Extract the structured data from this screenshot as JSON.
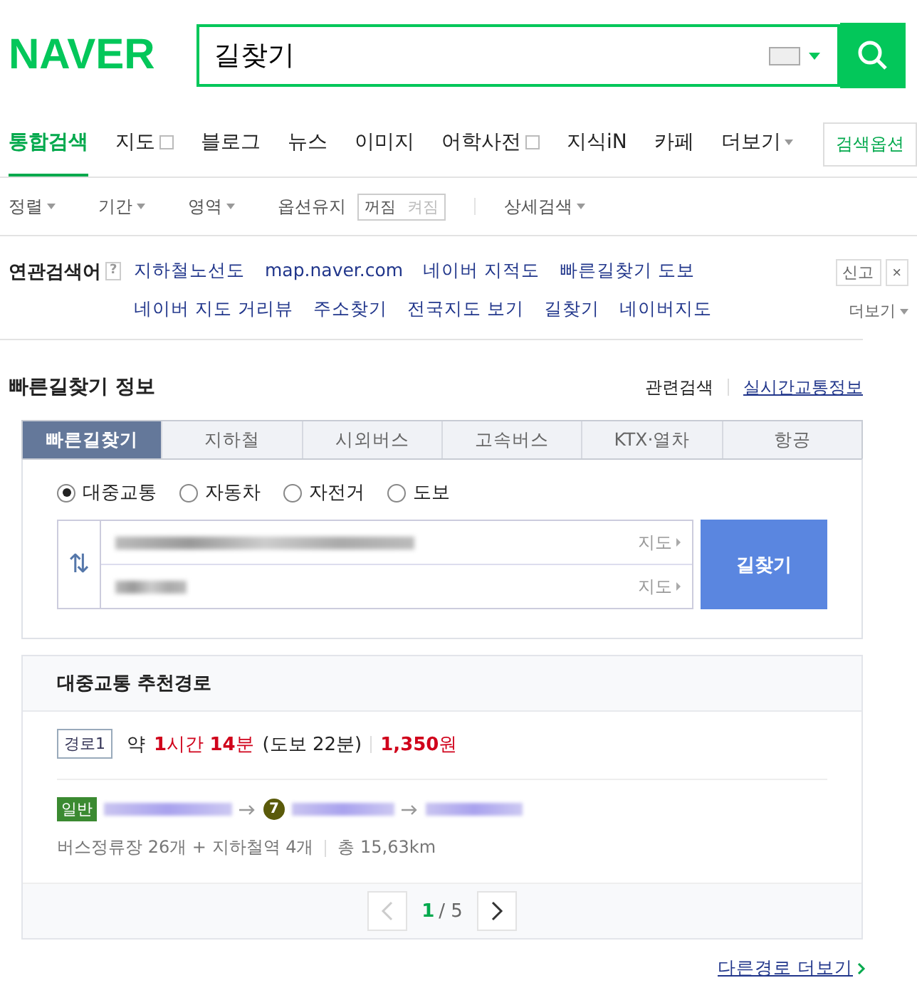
{
  "logo": "NAVER",
  "search": {
    "value": "길찾기"
  },
  "nav_tabs": [
    {
      "label": "통합검색",
      "selected": true
    },
    {
      "label": "지도",
      "selected": false,
      "popup": true
    },
    {
      "label": "블로그",
      "selected": false
    },
    {
      "label": "뉴스",
      "selected": false
    },
    {
      "label": "이미지",
      "selected": false
    },
    {
      "label": "어학사전",
      "selected": false,
      "popup": true
    },
    {
      "label": "지식iN",
      "selected": false
    },
    {
      "label": "카페",
      "selected": false
    },
    {
      "label": "더보기",
      "selected": false,
      "dropdown": true
    }
  ],
  "search_options_button": "검색옵션",
  "filters": [
    {
      "label": "정렬"
    },
    {
      "label": "기간"
    },
    {
      "label": "영역"
    }
  ],
  "option_keep": {
    "label": "옵션유지",
    "choices": [
      {
        "label": "꺼짐",
        "selected": true
      },
      {
        "label": "켜짐",
        "selected": false
      }
    ]
  },
  "detail_search": "상세검색",
  "related": {
    "title": "연관검색어",
    "help": "?",
    "report": "신고",
    "close": "×",
    "more": "더보기",
    "rows": [
      [
        "지하철노선도",
        "map.naver.com",
        "네이버 지적도",
        "빠른길찾기 도보"
      ],
      [
        "네이버 지도 거리뷰",
        "주소찾기",
        "전국지도 보기",
        "길찾기",
        "네이버지도"
      ]
    ]
  },
  "section": {
    "title": "빠른길찾기 정보",
    "links": [
      {
        "label": "관련검색",
        "underline": false
      },
      {
        "label": "실시간교통정보",
        "underline": true
      }
    ]
  },
  "route_tabs": [
    {
      "label": "빠른길찾기",
      "selected": true
    },
    {
      "label": "지하철",
      "selected": false
    },
    {
      "label": "시외버스",
      "selected": false
    },
    {
      "label": "고속버스",
      "selected": false
    },
    {
      "label": "KTX·열차",
      "selected": false
    },
    {
      "label": "항공",
      "selected": false
    }
  ],
  "modes": [
    {
      "label": "대중교통",
      "selected": true
    },
    {
      "label": "자동차",
      "selected": false
    },
    {
      "label": "자전거",
      "selected": false
    },
    {
      "label": "도보",
      "selected": false
    }
  ],
  "swap_icon": "⇅",
  "points": [
    {
      "map_link": "지도"
    },
    {
      "map_link": "지도"
    }
  ],
  "find_button": "길찾기",
  "result": {
    "title": "대중교통 추천경로",
    "route_tag": "경로1",
    "about": "약",
    "duration": "**1**시간 **14**분",
    "walk": "(도보 22분)",
    "fare": "**1,350**원",
    "bus_tag": "일반",
    "line_badge": "7",
    "stats": "버스정류장 26개 + 지하철역 4개",
    "distance": "총 15,63km",
    "page": "1",
    "pages": "/ 5"
  },
  "more_routes": "다른경로 더보기"
}
